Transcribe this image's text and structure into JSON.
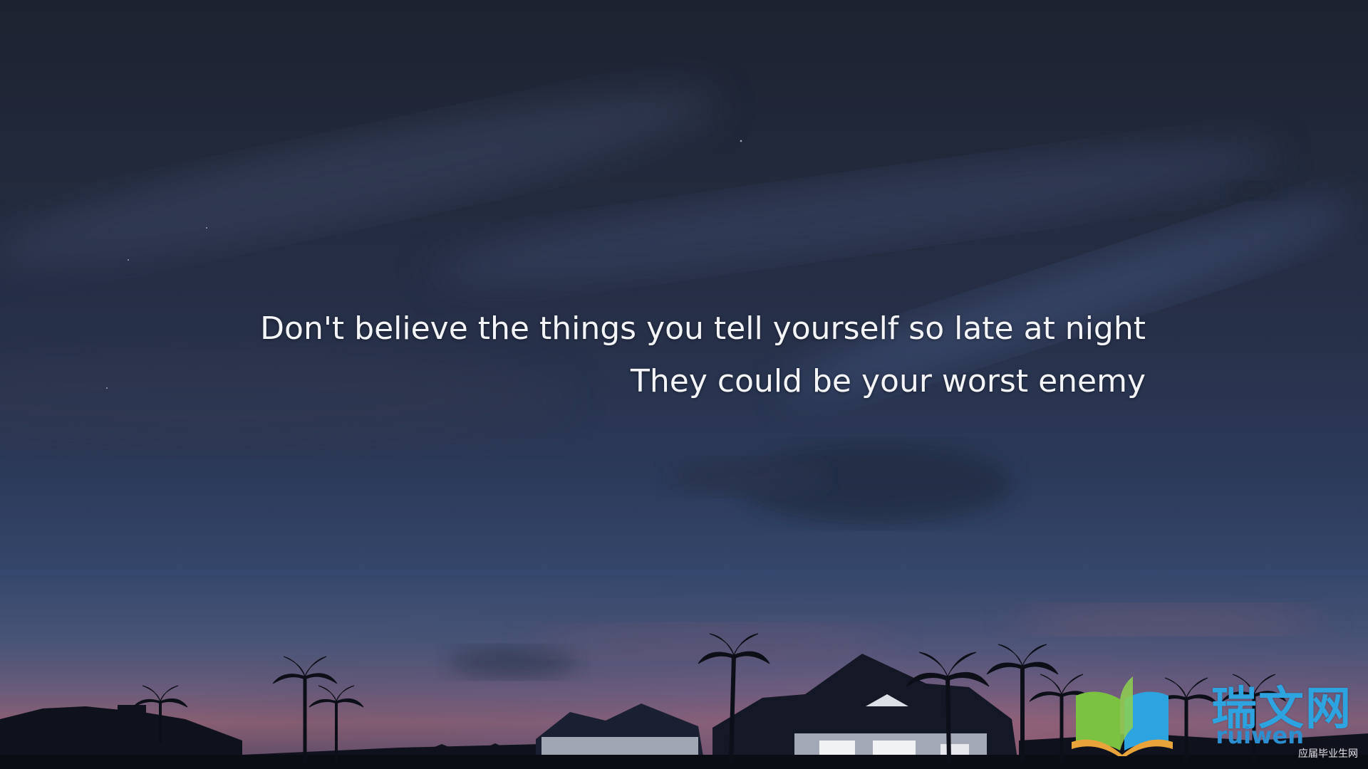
{
  "quote": {
    "line1": "Don't believe the things you tell yourself so late at night",
    "line2": "They could be your worst enemy"
  },
  "watermark": {
    "brand_cn": "瑞文网",
    "brand_en": "ruiwen",
    "sub_text": "应届毕业生网",
    "logo": "open-book-logo-icon"
  },
  "colors": {
    "text": "#f4f5f8",
    "watermark_blue": "#2da3e0",
    "watermark_green": "#7cc242"
  }
}
